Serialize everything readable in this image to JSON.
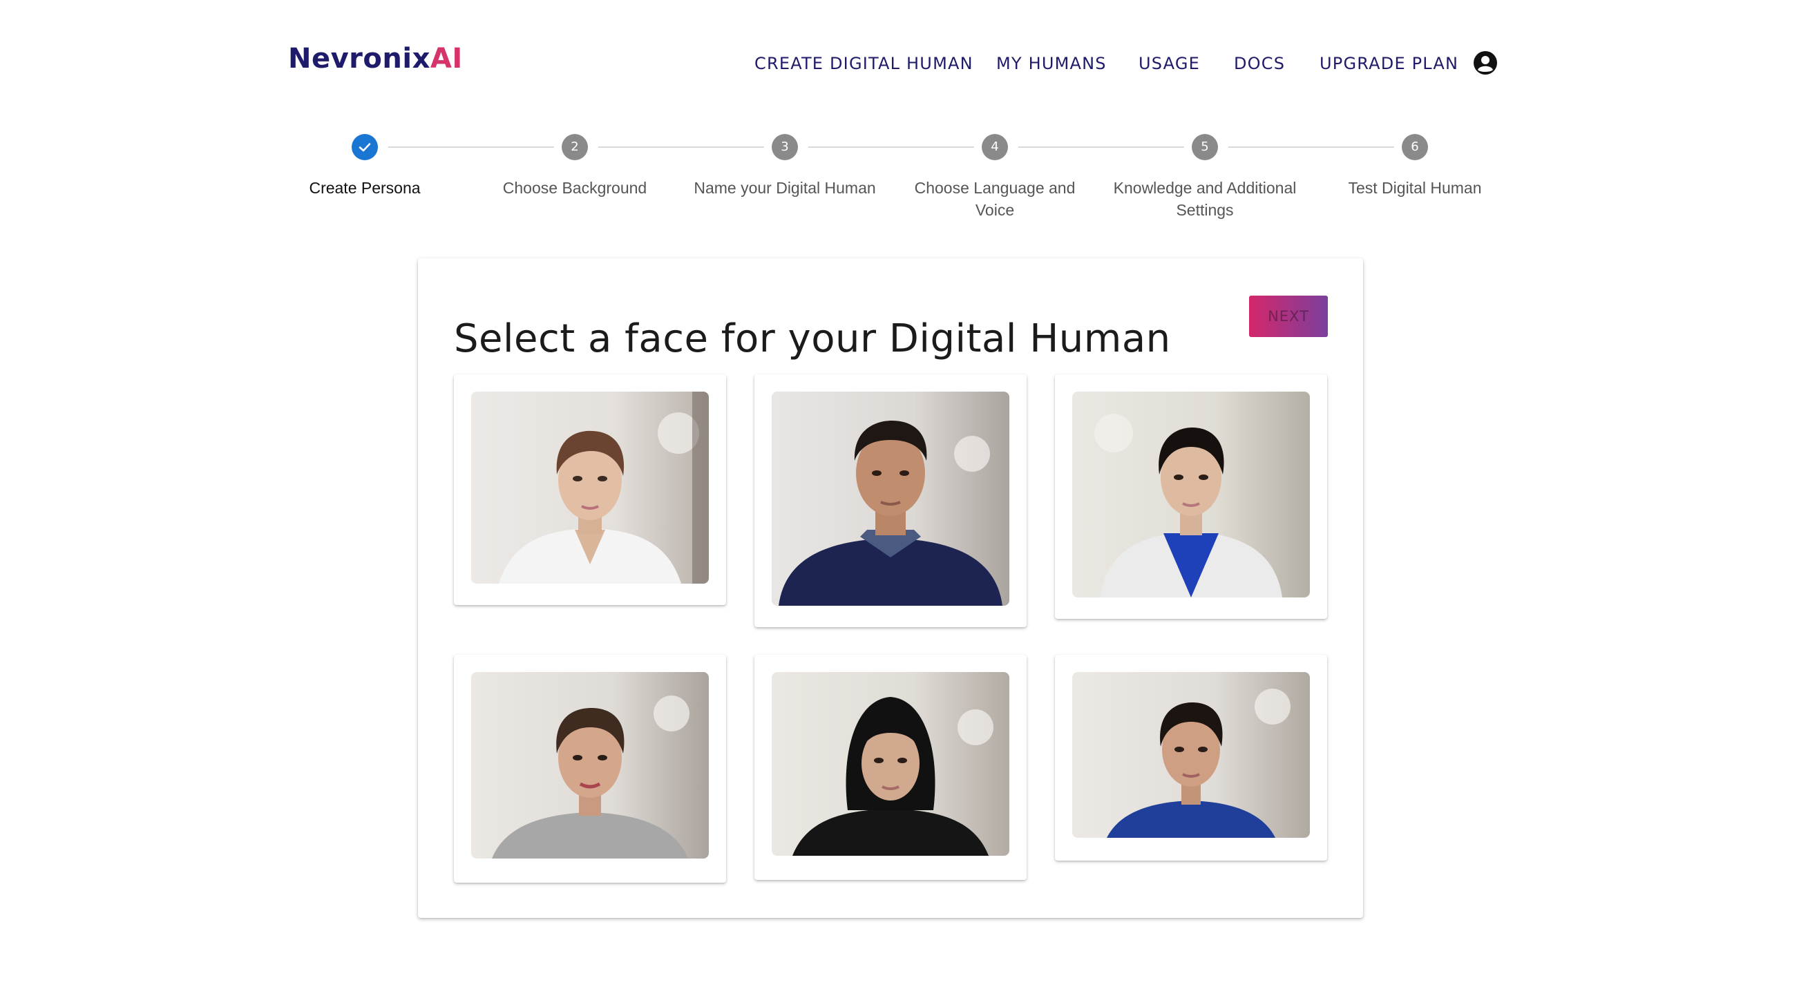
{
  "header": {
    "logo_brand": "Nevronix",
    "logo_ai": "AI",
    "nav": [
      {
        "label": "CREATE DIGITAL HUMAN"
      },
      {
        "label": "MY HUMANS"
      },
      {
        "label": "USAGE"
      },
      {
        "label": "DOCS"
      },
      {
        "label": "UPGRADE PLAN"
      }
    ],
    "account_icon": "account-circle-icon"
  },
  "stepper": {
    "steps": [
      {
        "number": "1",
        "label": "Create Persona",
        "status": "completed",
        "icon": "check-icon"
      },
      {
        "number": "2",
        "label": "Choose Background",
        "status": "pending"
      },
      {
        "number": "3",
        "label": "Name your Digital Human",
        "status": "pending"
      },
      {
        "number": "4",
        "label": "Choose Language and Voice",
        "status": "pending"
      },
      {
        "number": "5",
        "label": "Knowledge and Additional Settings",
        "status": "pending"
      },
      {
        "number": "6",
        "label": "Test Digital Human",
        "status": "pending"
      }
    ]
  },
  "main": {
    "title": "Select a face for your Digital Human",
    "next_label": "NEXT"
  },
  "colors": {
    "brand": "#1f1b6b",
    "accent": "#d6336c",
    "step_done": "#1976d2",
    "step_pending": "#8a8a8a",
    "next_gradient_start": "#d3286a",
    "next_gradient_end": "#7c3f9e"
  }
}
